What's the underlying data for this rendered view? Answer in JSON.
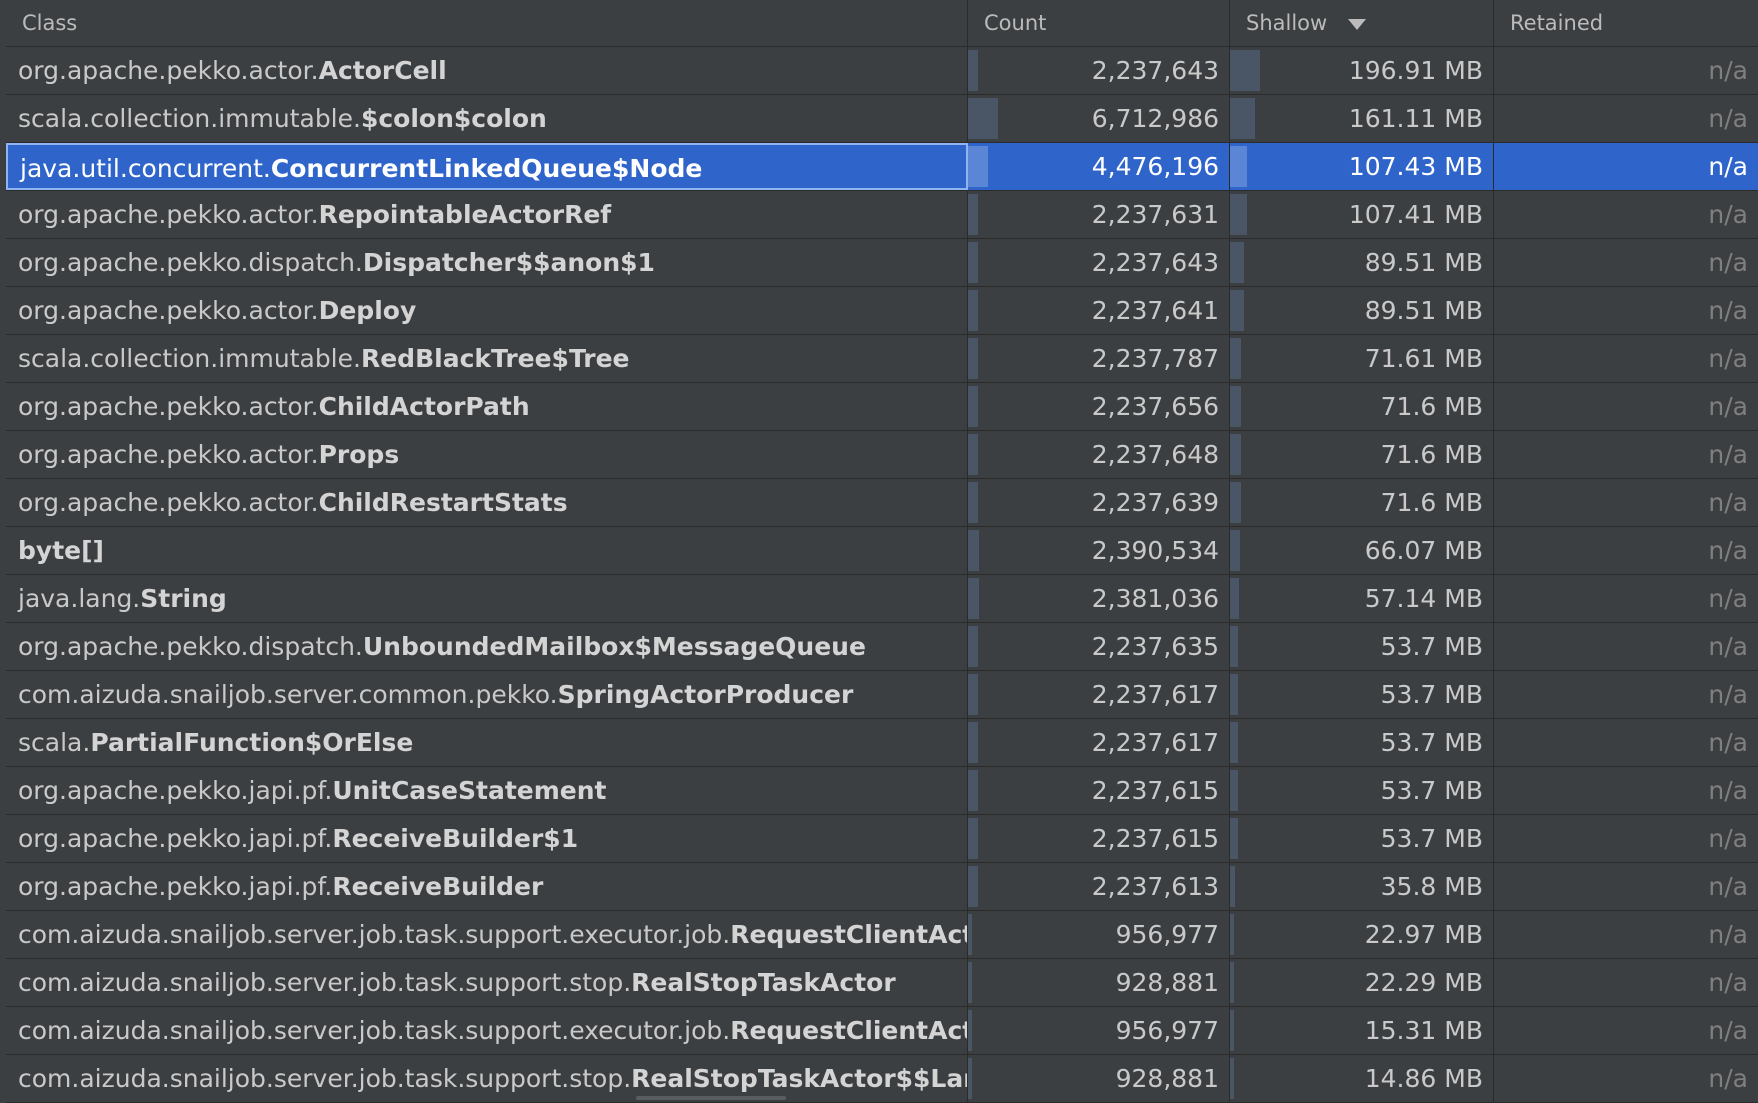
{
  "columns": {
    "class": "Class",
    "count": "Count",
    "shallow": "Shallow",
    "retained": "Retained",
    "sort_icon": "sort-descending-icon"
  },
  "rows": [
    {
      "pkg": "org.apache.pekko.actor.",
      "name": "ActorCell",
      "count": "2,237,643",
      "count_frac": 0.33,
      "shallow": "196.91 MB",
      "shallow_frac": 1.0,
      "retained": "n/a"
    },
    {
      "pkg": "scala.collection.immutable.",
      "name": "$colon$colon",
      "count": "6,712,986",
      "count_frac": 1.0,
      "shallow": "161.11 MB",
      "shallow_frac": 0.82,
      "retained": "n/a"
    },
    {
      "pkg": "java.util.concurrent.",
      "name": "ConcurrentLinkedQueue$Node",
      "count": "4,476,196",
      "count_frac": 0.67,
      "shallow": "107.43 MB",
      "shallow_frac": 0.55,
      "retained": "n/a",
      "selected": true
    },
    {
      "pkg": "org.apache.pekko.actor.",
      "name": "RepointableActorRef",
      "count": "2,237,631",
      "count_frac": 0.33,
      "shallow": "107.41 MB",
      "shallow_frac": 0.55,
      "retained": "n/a"
    },
    {
      "pkg": "org.apache.pekko.dispatch.",
      "name": "Dispatcher$$anon$1",
      "count": "2,237,643",
      "count_frac": 0.33,
      "shallow": "89.51 MB",
      "shallow_frac": 0.45,
      "retained": "n/a"
    },
    {
      "pkg": "org.apache.pekko.actor.",
      "name": "Deploy",
      "count": "2,237,641",
      "count_frac": 0.33,
      "shallow": "89.51 MB",
      "shallow_frac": 0.45,
      "retained": "n/a"
    },
    {
      "pkg": "scala.collection.immutable.",
      "name": "RedBlackTree$Tree",
      "count": "2,237,787",
      "count_frac": 0.33,
      "shallow": "71.61 MB",
      "shallow_frac": 0.36,
      "retained": "n/a"
    },
    {
      "pkg": "org.apache.pekko.actor.",
      "name": "ChildActorPath",
      "count": "2,237,656",
      "count_frac": 0.33,
      "shallow": "71.6 MB",
      "shallow_frac": 0.36,
      "retained": "n/a"
    },
    {
      "pkg": "org.apache.pekko.actor.",
      "name": "Props",
      "count": "2,237,648",
      "count_frac": 0.33,
      "shallow": "71.6 MB",
      "shallow_frac": 0.36,
      "retained": "n/a"
    },
    {
      "pkg": "org.apache.pekko.actor.",
      "name": "ChildRestartStats",
      "count": "2,237,639",
      "count_frac": 0.33,
      "shallow": "71.6 MB",
      "shallow_frac": 0.36,
      "retained": "n/a"
    },
    {
      "pkg": "",
      "name": "byte[]",
      "count": "2,390,534",
      "count_frac": 0.36,
      "shallow": "66.07 MB",
      "shallow_frac": 0.34,
      "retained": "n/a"
    },
    {
      "pkg": "java.lang.",
      "name": "String",
      "count": "2,381,036",
      "count_frac": 0.35,
      "shallow": "57.14 MB",
      "shallow_frac": 0.29,
      "retained": "n/a"
    },
    {
      "pkg": "org.apache.pekko.dispatch.",
      "name": "UnboundedMailbox$MessageQueue",
      "count": "2,237,635",
      "count_frac": 0.33,
      "shallow": "53.7 MB",
      "shallow_frac": 0.27,
      "retained": "n/a"
    },
    {
      "pkg": "com.aizuda.snailjob.server.common.pekko.",
      "name": "SpringActorProducer",
      "count": "2,237,617",
      "count_frac": 0.33,
      "shallow": "53.7 MB",
      "shallow_frac": 0.27,
      "retained": "n/a"
    },
    {
      "pkg": "scala.",
      "name": "PartialFunction$OrElse",
      "count": "2,237,617",
      "count_frac": 0.33,
      "shallow": "53.7 MB",
      "shallow_frac": 0.27,
      "retained": "n/a"
    },
    {
      "pkg": "org.apache.pekko.japi.pf.",
      "name": "UnitCaseStatement",
      "count": "2,237,615",
      "count_frac": 0.33,
      "shallow": "53.7 MB",
      "shallow_frac": 0.27,
      "retained": "n/a"
    },
    {
      "pkg": "org.apache.pekko.japi.pf.",
      "name": "ReceiveBuilder$1",
      "count": "2,237,615",
      "count_frac": 0.33,
      "shallow": "53.7 MB",
      "shallow_frac": 0.27,
      "retained": "n/a"
    },
    {
      "pkg": "org.apache.pekko.japi.pf.",
      "name": "ReceiveBuilder",
      "count": "2,237,613",
      "count_frac": 0.33,
      "shallow": "35.8 MB",
      "shallow_frac": 0.18,
      "retained": "n/a"
    },
    {
      "pkg": "com.aizuda.snailjob.server.job.task.support.executor.job.",
      "name": "RequestClientActor",
      "count": "956,977",
      "count_frac": 0.14,
      "shallow": "22.97 MB",
      "shallow_frac": 0.12,
      "retained": "n/a"
    },
    {
      "pkg": "com.aizuda.snailjob.server.job.task.support.stop.",
      "name": "RealStopTaskActor",
      "count": "928,881",
      "count_frac": 0.14,
      "shallow": "22.29 MB",
      "shallow_frac": 0.11,
      "retained": "n/a"
    },
    {
      "pkg": "com.aizuda.snailjob.server.job.task.support.executor.job.",
      "name": "RequestClientActor$",
      "count": "956,977",
      "count_frac": 0.14,
      "shallow": "15.31 MB",
      "shallow_frac": 0.08,
      "retained": "n/a"
    },
    {
      "pkg": "com.aizuda.snailjob.server.job.task.support.stop.",
      "name": "RealStopTaskActor$$Lambda",
      "count": "928,881",
      "count_frac": 0.14,
      "shallow": "14.86 MB",
      "shallow_frac": 0.08,
      "retained": "n/a"
    }
  ]
}
